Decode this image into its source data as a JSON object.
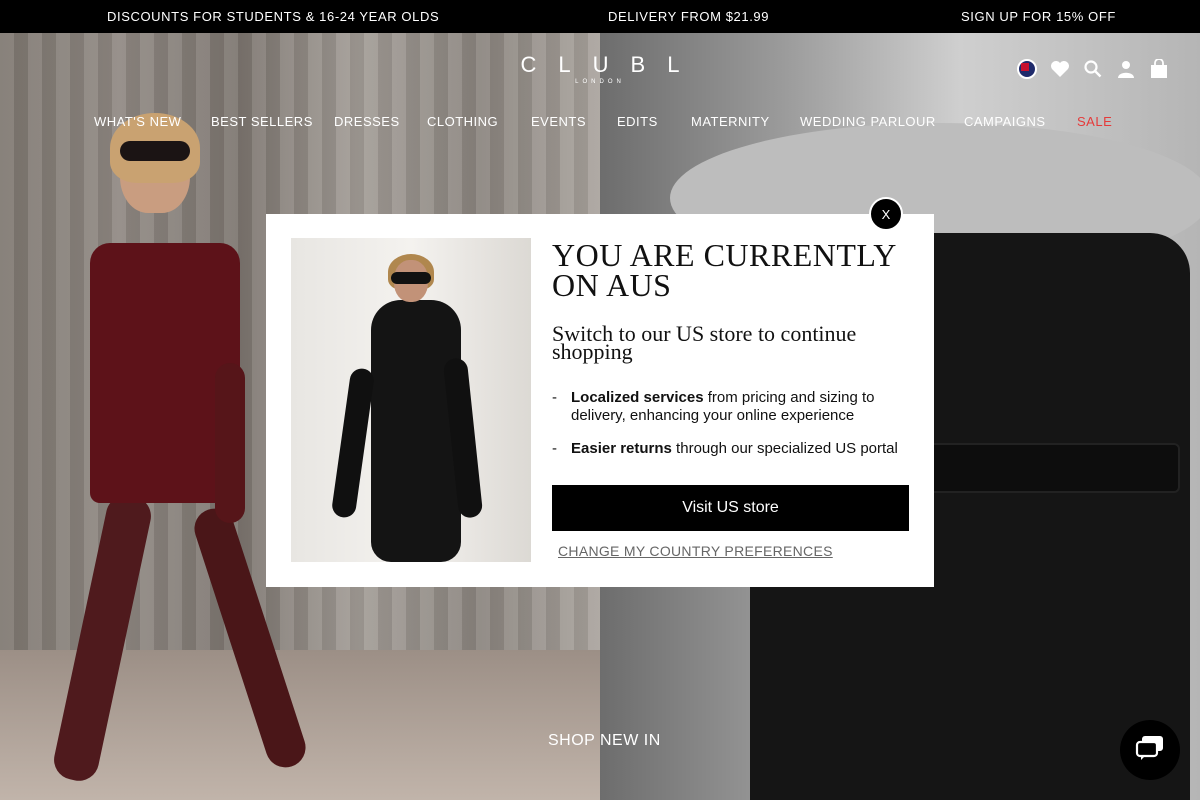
{
  "promo_bar": {
    "left": "DISCOUNTS FOR STUDENTS & 16-24 YEAR OLDS",
    "center": "DELIVERY FROM $21.99",
    "right": "SIGN UP FOR 15% OFF"
  },
  "header": {
    "logo": "CLUBL",
    "logo_sub": "LONDON",
    "icons": [
      "flag-icon",
      "heart-icon",
      "search-icon",
      "user-icon",
      "bag-icon"
    ]
  },
  "nav": {
    "items": [
      "WHAT'S NEW",
      "BEST SELLERS",
      "DRESSES",
      "CLOTHING",
      "EVENTS",
      "EDITS",
      "MATERNITY",
      "WEDDING PARLOUR",
      "CAMPAIGNS",
      "SALE"
    ],
    "sale_color": "#e53a3a"
  },
  "modal": {
    "close_label": "X",
    "title": "YOU ARE CURRENTLY ON AUS",
    "subtitle": "Switch to our US store to continue shopping",
    "benefits": [
      {
        "bold": "Localized services",
        "text": " from pricing and sizing to delivery, enhancing your online experience"
      },
      {
        "bold": "Easier returns",
        "text": " through our specialized US portal"
      }
    ],
    "primary_button": "Visit US store",
    "secondary_link": "CHANGE MY COUNTRY PREFERENCES"
  },
  "hero": {
    "cta": "SHOP NEW IN"
  },
  "chat": {
    "icon": "chat-icon"
  }
}
